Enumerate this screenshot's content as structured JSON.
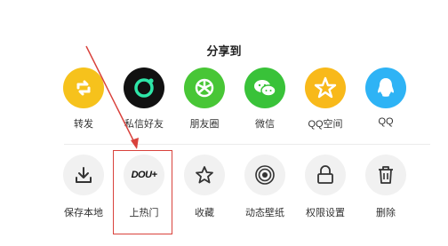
{
  "share_sheet": {
    "title": "分享到",
    "apps": [
      {
        "label": "转发",
        "icon": "repost-icon",
        "color": "#f6c21c"
      },
      {
        "label": "私信好友",
        "icon": "message-friend-icon",
        "color": "#111111"
      },
      {
        "label": "朋友圈",
        "icon": "moments-icon",
        "color": "#48c636"
      },
      {
        "label": "微信",
        "icon": "wechat-icon",
        "color": "#39c239"
      },
      {
        "label": "QQ空间",
        "icon": "qzone-icon",
        "color": "#f8b91a"
      },
      {
        "label": "QQ",
        "icon": "qq-icon",
        "color": "#2eb3f5"
      }
    ],
    "actions": [
      {
        "label": "保存本地",
        "icon": "download-icon"
      },
      {
        "label": "上热门",
        "icon": "dou-plus-icon",
        "icon_text": "DOU+"
      },
      {
        "label": "收藏",
        "icon": "star-icon"
      },
      {
        "label": "动态壁纸",
        "icon": "live-wallpaper-icon"
      },
      {
        "label": "权限设置",
        "icon": "lock-icon"
      },
      {
        "label": "删除",
        "icon": "trash-icon"
      }
    ]
  },
  "annotation": {
    "highlight_color": "#d9423c"
  }
}
